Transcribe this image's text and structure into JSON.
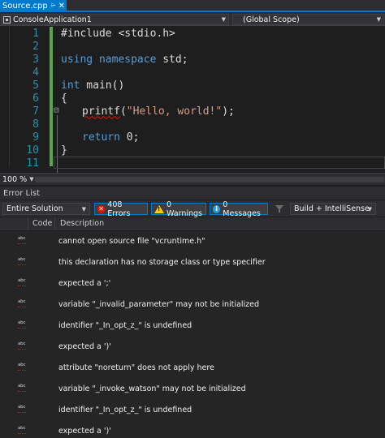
{
  "tab": {
    "title": "Source.cpp",
    "pin": "⌲",
    "close": "✕"
  },
  "nav": {
    "project": "ConsoleApplication1",
    "scope": "(Global Scope)"
  },
  "editor": {
    "lines": [
      {
        "n": "1"
      },
      {
        "n": "2"
      },
      {
        "n": "3"
      },
      {
        "n": "4"
      },
      {
        "n": "5"
      },
      {
        "n": "6"
      },
      {
        "n": "7"
      },
      {
        "n": "8"
      },
      {
        "n": "9"
      },
      {
        "n": "10"
      },
      {
        "n": "11"
      }
    ],
    "code": {
      "l1": "#include <stdio.h>",
      "l3_kw": "using namespace",
      "l3_rest": " std;",
      "l5_kw": "int",
      "l5_rest": " main()",
      "l6": "{",
      "l7_fn": "printf",
      "l7_open": "(",
      "l7_str": "\"Hello, world!\"",
      "l7_close": ");",
      "l9_kw": "return",
      "l9_rest": " 0;",
      "l10": "}"
    },
    "fold_symbol": "⊟"
  },
  "status": {
    "zoom": "100 %"
  },
  "error_list": {
    "title": "Error List",
    "scope": "Entire Solution",
    "errors_label": "408 Errors",
    "warnings_label": "0 Warnings",
    "messages_label": "0 Messages",
    "build_filter": "Build + IntelliSense",
    "columns": {
      "code": "Code",
      "description": "Description"
    },
    "items": [
      {
        "description": "cannot open source file \"vcruntime.h\""
      },
      {
        "description": "this declaration has no storage class or type specifier"
      },
      {
        "description": "expected a ';'"
      },
      {
        "description": "variable \"_invalid_parameter\" may not be initialized"
      },
      {
        "description": "identifier \"_In_opt_z_\" is undefined"
      },
      {
        "description": "expected a ')'"
      },
      {
        "description": "attribute \"noreturn\" does not apply here"
      },
      {
        "description": "variable \"_invoke_watson\" may not be initialized"
      },
      {
        "description": "identifier \"_In_opt_z_\" is undefined"
      },
      {
        "description": "expected a ')'"
      }
    ],
    "icon_text": "abc"
  },
  "colors": {
    "accent": "#007acc",
    "error": "#e51400",
    "warning": "#ffcc00",
    "info": "#1ba1e2"
  }
}
